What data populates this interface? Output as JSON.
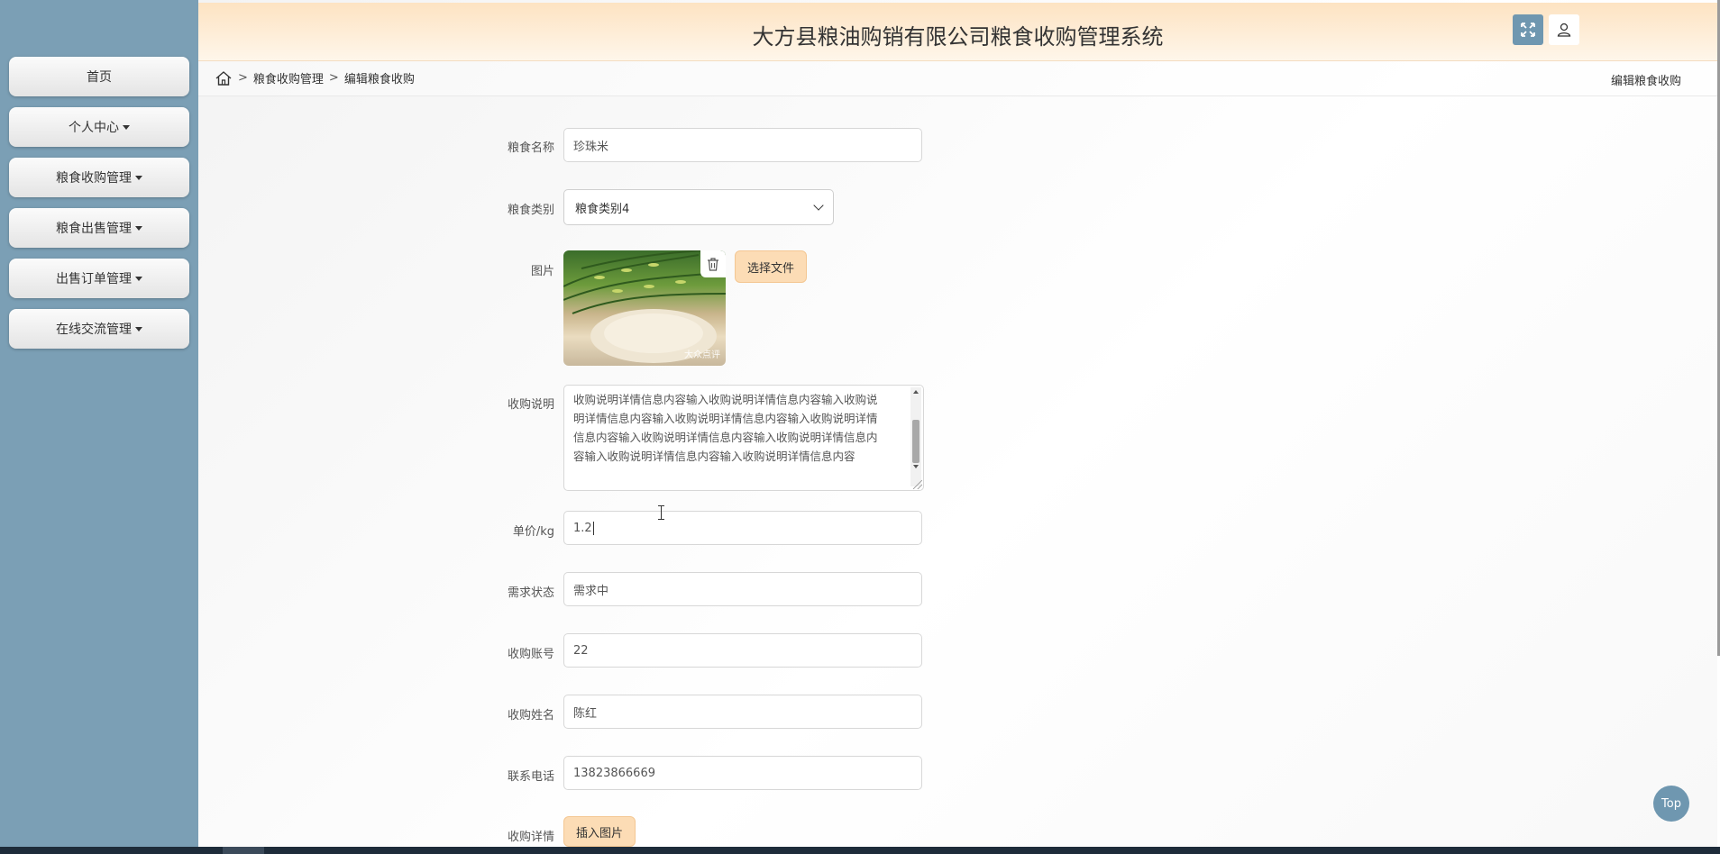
{
  "sidebar": {
    "items": [
      {
        "label": "首页",
        "has_caret": false
      },
      {
        "label": "个人中心",
        "has_caret": true
      },
      {
        "label": "粮食收购管理",
        "has_caret": true
      },
      {
        "label": "粮食出售管理",
        "has_caret": true
      },
      {
        "label": "出售订单管理",
        "has_caret": true
      },
      {
        "label": "在线交流管理",
        "has_caret": true
      }
    ]
  },
  "header": {
    "title": "大方县粮油购销有限公司粮食收购管理系统",
    "fullscreen_icon": "expand-icon",
    "user_icon": "user-icon",
    "accent": "#6f97b0"
  },
  "breadcrumb": {
    "home_icon": "home-icon",
    "separator": ">",
    "items": [
      "粮食收购管理",
      "编辑粮食收购"
    ],
    "right_title": "编辑粮食收购"
  },
  "form": {
    "name": {
      "label": "粮食名称",
      "value": "珍珠米"
    },
    "category": {
      "label": "粮食类别",
      "value": "粮食类别4"
    },
    "image": {
      "label": "图片",
      "delete_icon": "trash-icon",
      "choose_file_label": "选择文件",
      "watermark": "大众点评"
    },
    "description": {
      "label": "收购说明",
      "value": "收购说明详情信息内容输入收购说明详情信息内容输入收购说明详情信息内容输入收购说明详情信息内容输入收购说明详情信息内容输入收购说明详情信息内容输入收购说明详情信息内容输入收购说明详情信息内容输入收购说明详情信息内容"
    },
    "price": {
      "label": "单价/kg",
      "value": "1.2"
    },
    "status": {
      "label": "需求状态",
      "value": "需求中"
    },
    "account": {
      "label": "收购账号",
      "value": "22"
    },
    "buyer_name": {
      "label": "收购姓名",
      "value": "陈红"
    },
    "phone": {
      "label": "联系电话",
      "value": "13823866669"
    },
    "detail": {
      "label": "收购详情",
      "insert_image_label": "插入图片"
    }
  },
  "top_button": {
    "label": "Top"
  },
  "colors": {
    "sidebar": "#7b9fb5",
    "header_gradient_top": "#fde3c2",
    "peach_button": "#fcdcb5"
  }
}
